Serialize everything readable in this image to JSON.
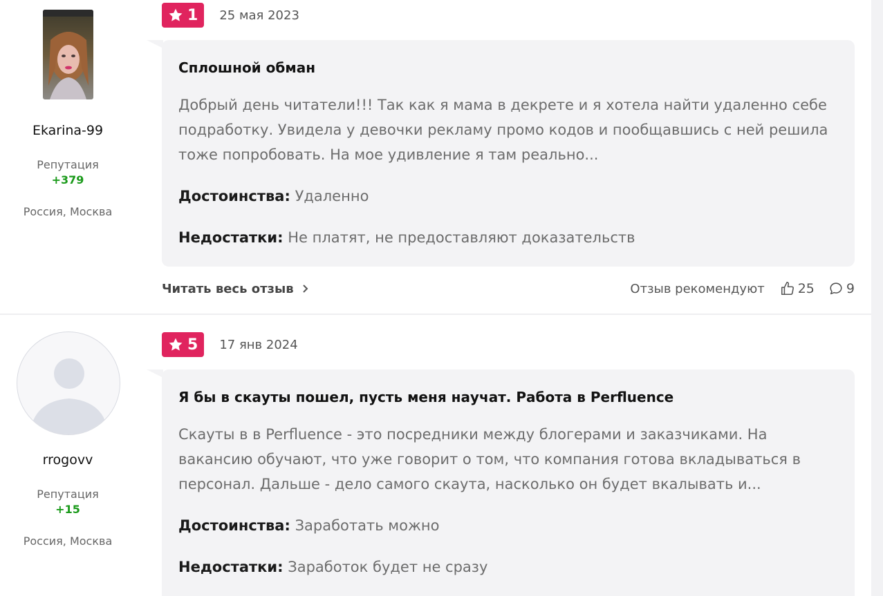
{
  "reviews": [
    {
      "author": {
        "username": "Ekarina-99",
        "reputation_label": "Репутация",
        "reputation_value": "+379",
        "location": "Россия, Москва",
        "avatar": "photo"
      },
      "rating": "1",
      "date": "25 мая 2023",
      "title": "Сплошной обман",
      "text": "Добрый день читатели!!! Так как я мама в декрете и я хотела найти удаленно себе подработку. Увидела у девочки рекламу промо кодов и пообщавшись с ней решила тоже попробовать. На мое удивление я там реально...",
      "pros_label": "Достоинства:",
      "pros": "Удаленно",
      "cons_label": "Недостатки:",
      "cons": "Не платят, не предоставляют доказательств",
      "read_more": "Читать весь отзыв",
      "recommend_label": "Отзыв рекомендуют",
      "likes": "25",
      "comments": "9"
    },
    {
      "author": {
        "username": "rrogovv",
        "reputation_label": "Репутация",
        "reputation_value": "+15",
        "location": "Россия, Москва",
        "avatar": "default-user-icon"
      },
      "rating": "5",
      "date": "17 янв 2024",
      "title": "Я бы в скауты пошел, пусть меня научат. Работа в Perfluence",
      "text": "Скауты в в Perfluence - это посредники между блогерами и заказчиками. На вакансию обучают, что уже говорит о том, что компания готова вкладываться в персонал. Дальше - дело самого скаута, насколько он будет вкалывать и...",
      "pros_label": "Достоинства:",
      "pros": "Заработать можно",
      "cons_label": "Недостатки:",
      "cons": "Заработок будет не сразу"
    }
  ],
  "colors": {
    "rating_badge": "#e0245e",
    "reputation": "#1a9a1a",
    "card_bg": "#f3f3f5"
  },
  "icons": [
    "star-icon",
    "thumbs-up-icon",
    "comment-icon",
    "chevron-right-icon",
    "user-placeholder-icon"
  ]
}
